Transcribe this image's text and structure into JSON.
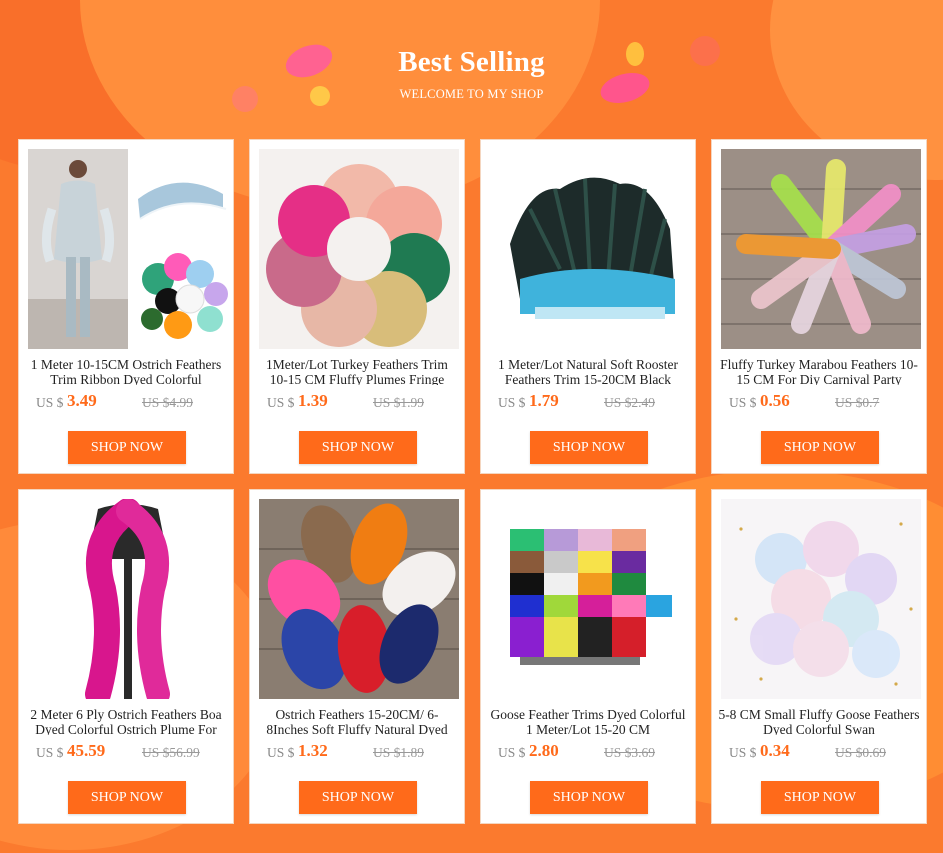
{
  "header": {
    "title": "Best Selling",
    "subtitle": "WELCOME TO MY SHOP"
  },
  "colors": {
    "background": "#fb7a2e",
    "accent": "#ff6a1a",
    "card": "#ffffff"
  },
  "products": [
    {
      "name": "1 Meter 10-15CM Ostrich Feathers Trim Ribbon Dyed Colorful",
      "currency": "US $",
      "price": "3.49",
      "old_price": "US $4.99",
      "button": "SHOP NOW",
      "image": "model-with-ostrich-feather-trims"
    },
    {
      "name": "1Meter/Lot Turkey Feathers Trim 10-15 CM Fluffy Plumes Fringe",
      "currency": "US $",
      "price": "1.39",
      "old_price": "US $1.99",
      "button": "SHOP NOW",
      "image": "colorful-turkey-feather-wreath"
    },
    {
      "name": "1 Meter/Lot Natural Soft Rooster Feathers Trim 15-20CM Black",
      "currency": "US $",
      "price": "1.79",
      "old_price": "US $2.49",
      "button": "SHOP NOW",
      "image": "black-blue-rooster-feather-trim"
    },
    {
      "name": "Fluffy Turkey Marabou Feathers 10-15 CM For Diy Carnival Party",
      "currency": "US $",
      "price": "0.56",
      "old_price": "US $0.7",
      "button": "SHOP NOW",
      "image": "pastel-marabou-feathers-on-wood"
    },
    {
      "name": "2 Meter 6 Ply Ostrich Feathers Boa Dyed Colorful Ostrich Plume For",
      "currency": "US $",
      "price": "45.59",
      "old_price": "US $56.99",
      "button": "SHOP NOW",
      "image": "magenta-ostrich-feather-boa"
    },
    {
      "name": "Ostrich Feathers 15-20CM/ 6-8Inches Soft Fluffy Natural Dyed",
      "currency": "US $",
      "price": "1.32",
      "old_price": "US $1.89",
      "button": "SHOP NOW",
      "image": "colorful-ostrich-plumes-on-wood"
    },
    {
      "name": "Goose Feather Trims Dyed Colorful 1 Meter/Lot 15-20 CM",
      "currency": "US $",
      "price": "2.80",
      "old_price": "US $3.69",
      "button": "SHOP NOW",
      "image": "goose-feather-trims-color-grid"
    },
    {
      "name": "5-8 CM Small Fluffy Goose Feathers Dyed Colorful Swan",
      "currency": "US $",
      "price": "0.34",
      "old_price": "US $0.69",
      "button": "SHOP NOW",
      "image": "pastel-small-goose-feathers"
    }
  ]
}
